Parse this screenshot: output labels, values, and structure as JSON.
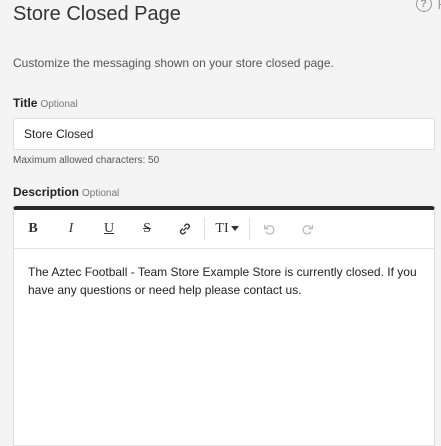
{
  "header": {
    "title": "Store Closed Page",
    "help_label": "H"
  },
  "subtitle": "Customize the messaging shown on your store closed page.",
  "title_field": {
    "label": "Title",
    "optional": "Optional",
    "value": "Store Closed",
    "hint": "Maximum allowed characters: 50"
  },
  "description_field": {
    "label": "Description",
    "optional": "Optional",
    "content": "The Aztec Football - Team Store Example Store is currently closed. If you have any questions or need help please contact us."
  },
  "toolbar": {
    "bold": "B",
    "italic": "I",
    "underline": "U",
    "strike": "S",
    "text_size": "TI"
  },
  "icons": {
    "help": "question-circle-icon",
    "link": "link-icon",
    "undo": "undo-icon",
    "redo": "redo-icon",
    "dropdown": "caret-down-icon"
  }
}
